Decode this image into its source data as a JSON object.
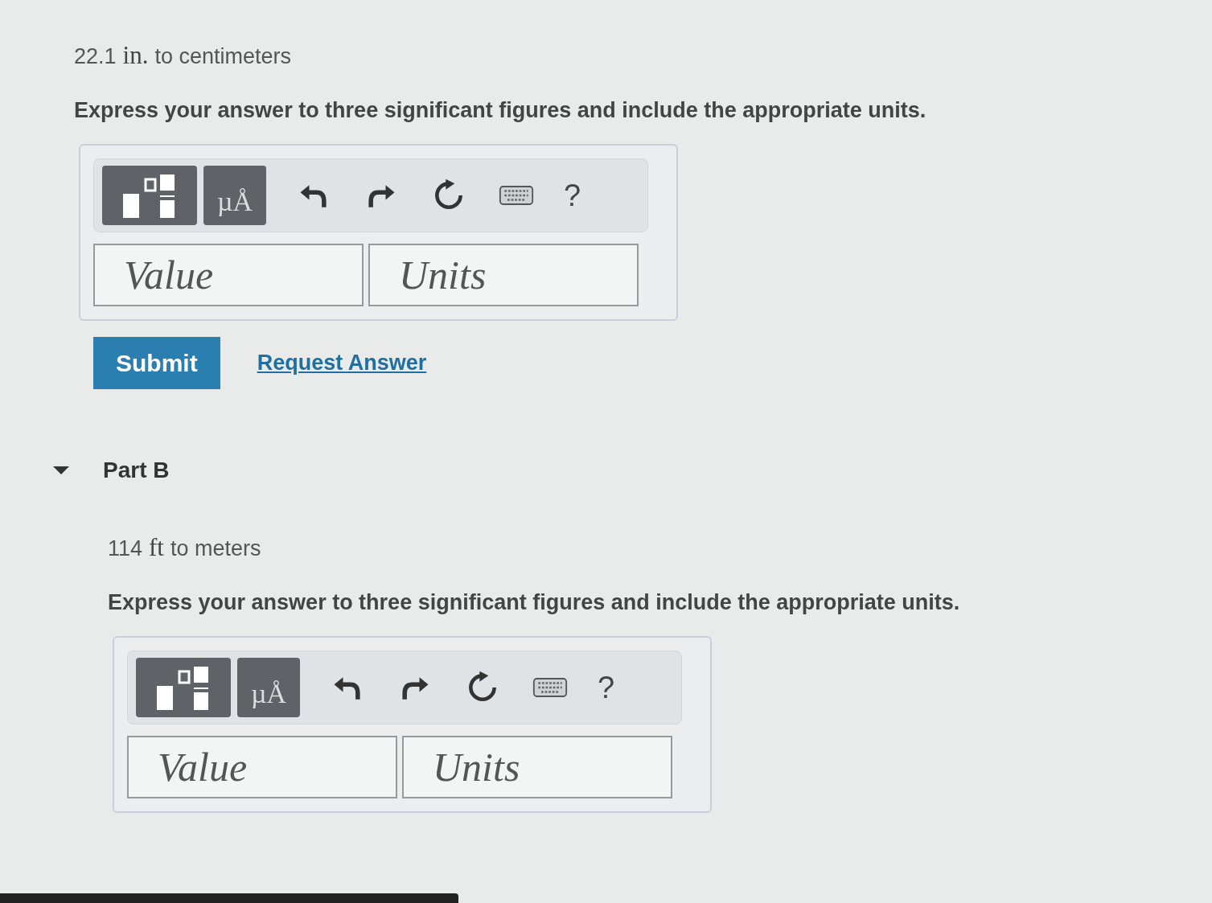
{
  "parts": [
    {
      "prompt": {
        "number": "22.1",
        "unit": "in.",
        "rest": "to centimeters"
      },
      "instruction": "Express your answer to three significant figures and include the appropriate units.",
      "toolbar": {
        "units_button": "µÅ",
        "help": "?"
      },
      "value_placeholder": "Value",
      "units_placeholder": "Units",
      "submit": "Submit",
      "request": "Request Answer"
    },
    {
      "heading": "Part B",
      "expanded": true,
      "prompt": {
        "number": "114",
        "unit": "ft",
        "rest": "to meters"
      },
      "instruction": "Express your answer to three significant figures and include the appropriate units.",
      "toolbar": {
        "units_button": "µÅ",
        "help": "?"
      },
      "value_placeholder": "Value",
      "units_placeholder": "Units"
    }
  ]
}
